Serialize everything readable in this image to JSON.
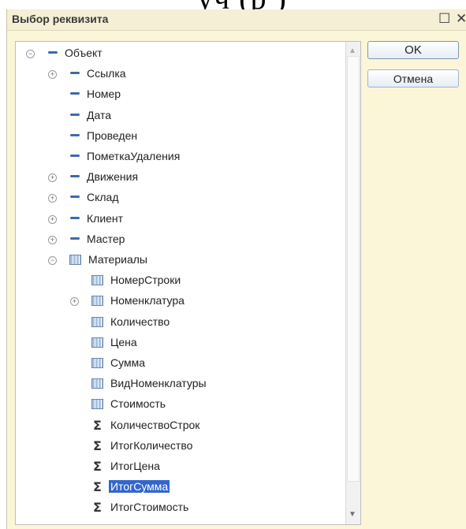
{
  "top_caption": "уч   (р        )",
  "window": {
    "title": "Выбор реквизита",
    "maximize_glyph": "☐",
    "close_glyph": "✕"
  },
  "buttons": {
    "ok": "OK",
    "cancel": "Отмена"
  },
  "scrollbar": {
    "up_glyph": "▲",
    "down_glyph": "▼"
  },
  "tree": [
    {
      "label": "Объект",
      "icon": "attribute-icon",
      "expander": "minus",
      "level": 0
    },
    {
      "label": "Ссылка",
      "icon": "attribute-icon",
      "expander": "plus",
      "level": 1
    },
    {
      "label": "Номер",
      "icon": "attribute-icon",
      "expander": "",
      "level": 1
    },
    {
      "label": "Дата",
      "icon": "attribute-icon",
      "expander": "",
      "level": 1
    },
    {
      "label": "Проведен",
      "icon": "attribute-icon",
      "expander": "",
      "level": 1
    },
    {
      "label": "ПометкаУдаления",
      "icon": "attribute-icon",
      "expander": "",
      "level": 1
    },
    {
      "label": "Движения",
      "icon": "attribute-icon",
      "expander": "plus",
      "level": 1
    },
    {
      "label": "Склад",
      "icon": "attribute-icon",
      "expander": "plus",
      "level": 1
    },
    {
      "label": "Клиент",
      "icon": "attribute-icon",
      "expander": "plus",
      "level": 1
    },
    {
      "label": "Мастер",
      "icon": "attribute-icon",
      "expander": "plus",
      "level": 1
    },
    {
      "label": "Материалы",
      "icon": "table-icon",
      "expander": "minus",
      "level": 1
    },
    {
      "label": "НомерСтроки",
      "icon": "table-icon",
      "expander": "",
      "level": 2
    },
    {
      "label": "Номенклатура",
      "icon": "table-icon",
      "expander": "plus",
      "level": 2
    },
    {
      "label": "Количество",
      "icon": "table-icon",
      "expander": "",
      "level": 2
    },
    {
      "label": "Цена",
      "icon": "table-icon",
      "expander": "",
      "level": 2
    },
    {
      "label": "Сумма",
      "icon": "table-icon",
      "expander": "",
      "level": 2
    },
    {
      "label": "ВидНоменклатуры",
      "icon": "table-icon",
      "expander": "",
      "level": 2
    },
    {
      "label": "Стоимость",
      "icon": "table-icon",
      "expander": "",
      "level": 2
    },
    {
      "label": "КоличествоСтрок",
      "icon": "sum-icon",
      "expander": "",
      "level": 2
    },
    {
      "label": "ИтогКоличество",
      "icon": "sum-icon",
      "expander": "",
      "level": 2
    },
    {
      "label": "ИтогЦена",
      "icon": "sum-icon",
      "expander": "",
      "level": 2
    },
    {
      "label": "ИтогСумма",
      "icon": "sum-icon",
      "expander": "",
      "level": 2,
      "selected": true
    },
    {
      "label": "ИтогСтоимость",
      "icon": "sum-icon",
      "expander": "",
      "level": 2
    }
  ]
}
